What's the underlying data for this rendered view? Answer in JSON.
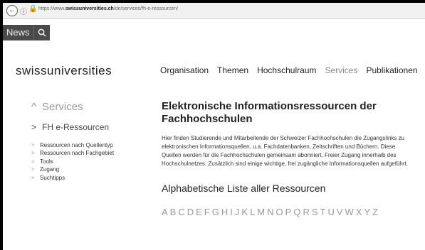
{
  "browser": {
    "url_prefix": "https://www.",
    "url_domain": "swissuniversities.ch",
    "url_path": "/de/services/fh-e-ressourcen/"
  },
  "topbar": {
    "news_label": "News"
  },
  "header": {
    "logo_text": "swissuniversities",
    "nav": [
      "Organisation",
      "Themen",
      "Hochschulraum",
      "Services",
      "Publikationen"
    ],
    "active_nav": "Services"
  },
  "sidebar": {
    "section_label": "Services",
    "current_label": "FH e-Ressourcen",
    "items": [
      "Ressourcen nach Quellentyp",
      "Ressourcen nach Fachgebiet",
      "Tools",
      "Zugang",
      "Suchtipps"
    ]
  },
  "main": {
    "title": "Elektronische Informationsressourcen der Fachhochschulen",
    "intro": "Hier finden Studierende und Mitarbeitende der Schweizer Fachhochschulen die Zugangslinks zu elektronischen Informationsquellen, u.a. Fachdatenbanken, Zeitschriften und Büchern. Diese Quellen werden für die Fachhochschulen gemeinsam abonniert. Freier Zugang innerhalb des Hochschulnetzes. Zusätzlich sind einige wichtige, frei zugängliche Informationsquellen aufgeführt.",
    "az_title": "Alphabetische Liste aller Ressourcen",
    "letters": [
      "A",
      "B",
      "C",
      "D",
      "E",
      "F",
      "G",
      "H",
      "I",
      "J",
      "K",
      "L",
      "M",
      "N",
      "O",
      "P",
      "Q",
      "R",
      "S",
      "T",
      "U",
      "V",
      "W",
      "X",
      "Y",
      "Z"
    ]
  }
}
